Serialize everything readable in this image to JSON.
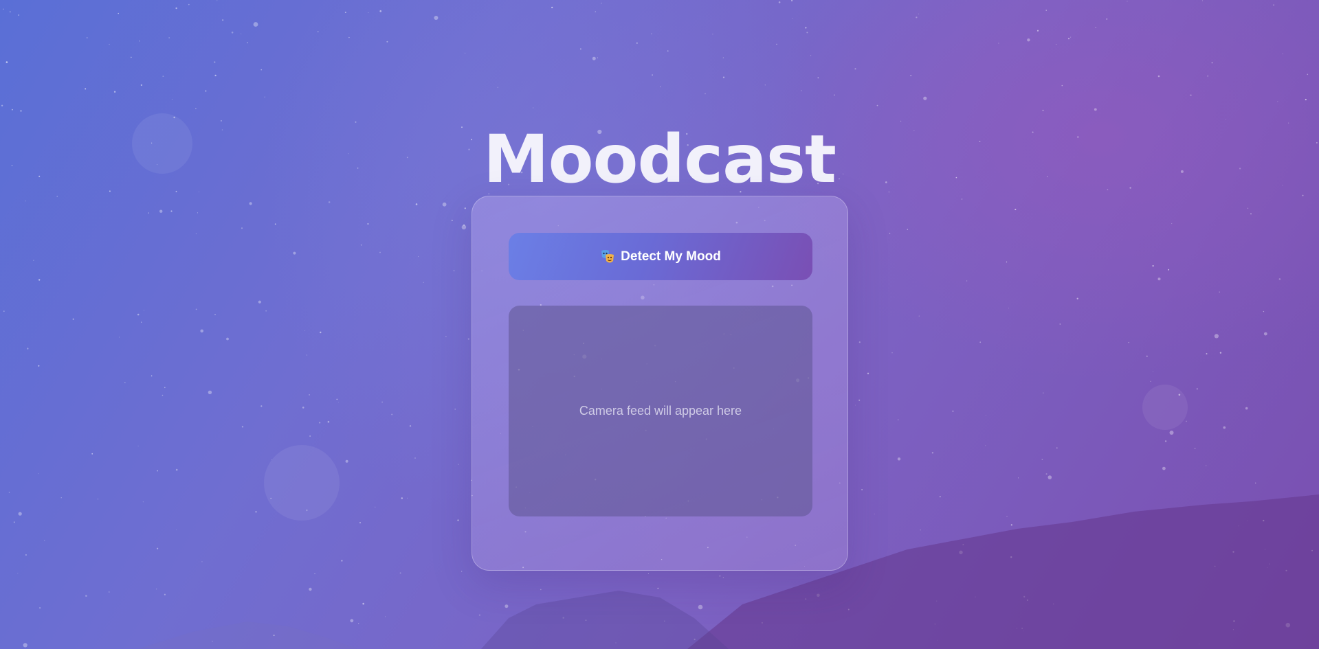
{
  "app": {
    "title": "Moodcast"
  },
  "detect_button": {
    "icon": "theater-masks-icon",
    "label": "Detect My Mood"
  },
  "camera": {
    "placeholder": "Camera feed will appear here"
  },
  "colors": {
    "background_start": "#5a6fd6",
    "background_end": "#7a4fb0",
    "button_start": "#6b7fe6",
    "button_end": "#7a4fb4",
    "title_text": "#f2f1fb"
  }
}
